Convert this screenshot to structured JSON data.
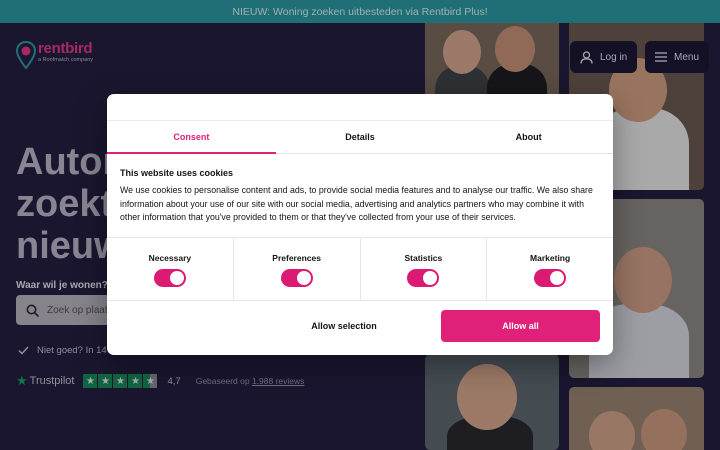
{
  "promo": {
    "text": "NIEUW: Woning zoeken uitbesteden via Rentbird Plus!"
  },
  "logo": {
    "name": "rentbird",
    "tagline": "a Roofmatch company",
    "icon": "location-pin-bird-icon"
  },
  "header": {
    "login_label": "Log in",
    "menu_label": "Menu"
  },
  "hero": {
    "title_lines": [
      "Autor",
      "zoekt",
      "nieuw"
    ],
    "search_label": "Waar wil je wonen?",
    "search_placeholder": "Zoek op plaats"
  },
  "guarantee": {
    "text": "Niet goed? In 14 d"
  },
  "trustpilot": {
    "brand": "Trustpilot",
    "rating": "4,7",
    "stars_filled": 4.5,
    "stars_total": 5,
    "based_on_prefix": "Gebaseerd op",
    "reviews_link": "1.988 reviews"
  },
  "cookie_dialog": {
    "tabs": [
      {
        "label": "Consent",
        "active": true
      },
      {
        "label": "Details",
        "active": false
      },
      {
        "label": "About",
        "active": false
      }
    ],
    "title": "This website uses cookies",
    "body": "We use cookies to personalise content and ads, to provide social media features and to analyse our traffic. We also share information about your use of our site with our social media, advertising and analytics partners who may combine it with other information that you've provided to them or that they've collected from your use of their services.",
    "toggles": [
      {
        "label": "Necessary",
        "on": true
      },
      {
        "label": "Preferences",
        "on": true
      },
      {
        "label": "Statistics",
        "on": true
      },
      {
        "label": "Marketing",
        "on": true
      }
    ],
    "allow_selection_label": "Allow selection",
    "allow_all_label": "Allow all"
  },
  "colors": {
    "brand_pink": "#e0217a",
    "promo_teal": "#2d9aa6",
    "page_bg": "#241f42",
    "trustpilot_green": "#1a8c5e"
  }
}
